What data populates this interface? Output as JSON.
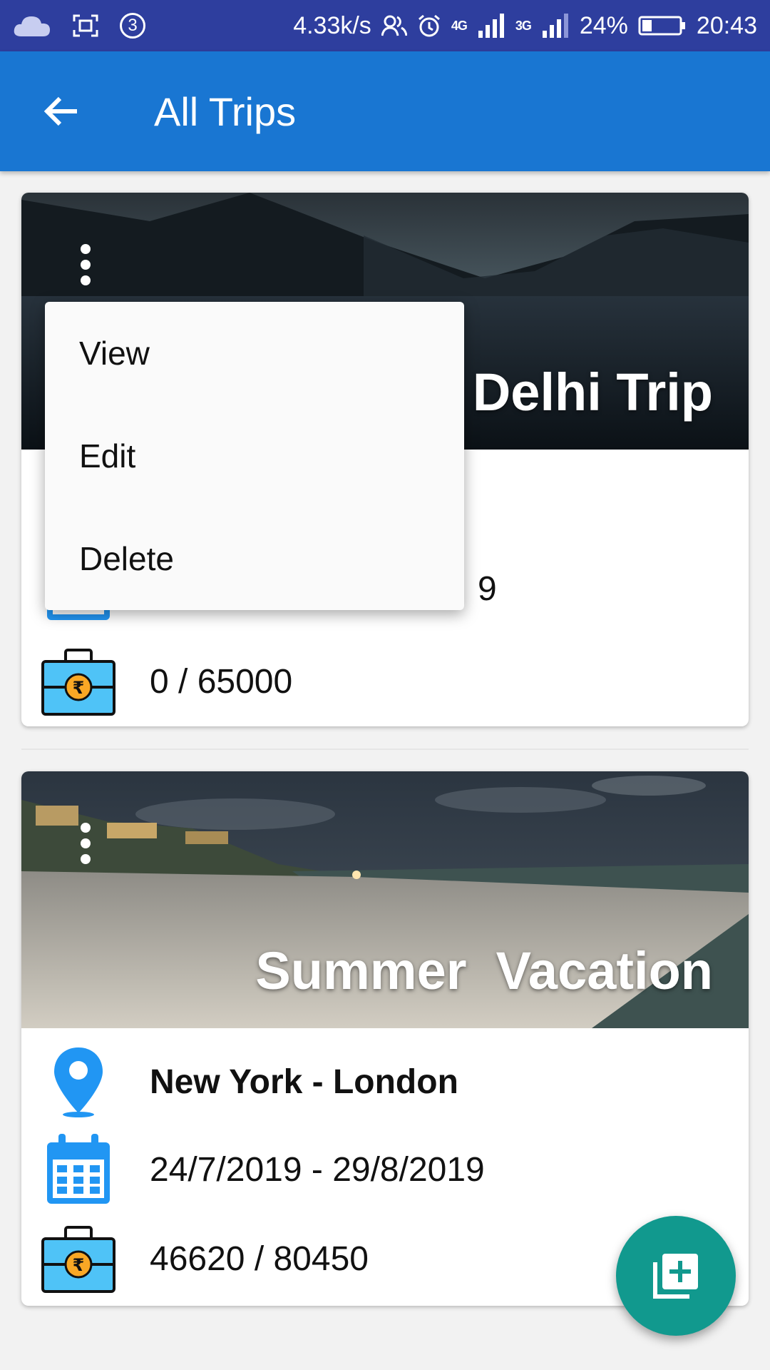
{
  "status_bar": {
    "notification_count": "3",
    "network_speed": "4.33k/s",
    "signal_primary": "4G",
    "signal_secondary": "3G",
    "battery": "24%",
    "time": "20:43"
  },
  "app_bar": {
    "title": "All Trips",
    "back_icon": "arrow-back-icon"
  },
  "trips": [
    {
      "title": "Delhi Trip",
      "visible_title_fragment": "r Delhi Trip",
      "date_fragment": "9",
      "budget": "0 / 65000"
    },
    {
      "title": "Summer  Vacation",
      "route": "New York - London",
      "dates": "24/7/2019 - 29/8/2019",
      "budget": "46620 / 80450"
    }
  ],
  "context_menu": {
    "items": [
      "View",
      "Edit",
      "Delete"
    ]
  },
  "fab": {
    "icon": "add-to-library-icon"
  },
  "colors": {
    "status_bar": "#2e3e9e",
    "app_bar": "#1976d2",
    "fab": "#11998e",
    "icon_blue": "#2196f3"
  }
}
